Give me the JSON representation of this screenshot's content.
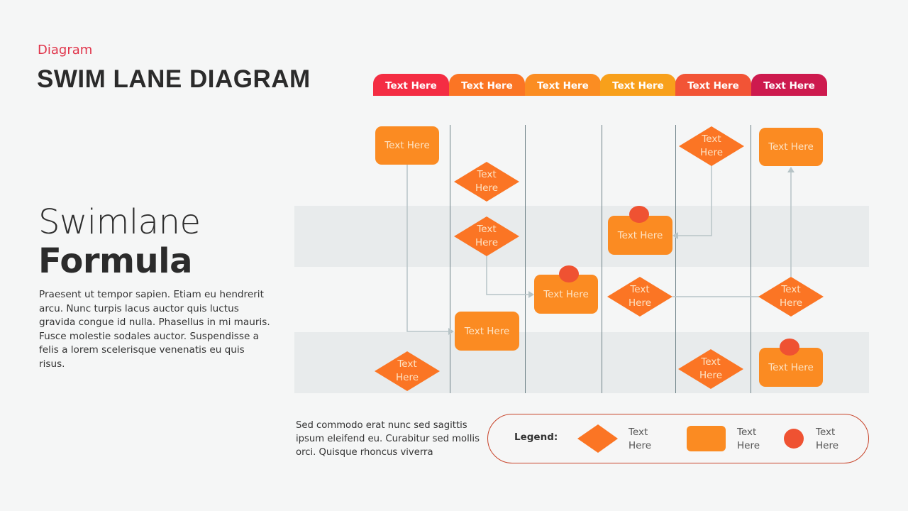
{
  "header": {
    "category": "Diagram",
    "title": "SWIM LANE DIAGRAM"
  },
  "intro": {
    "heading_light": "Swimlane",
    "heading_bold": "Formula",
    "paragraph": "Praesent ut tempor  sapien. Etiam eu hendrerit arcu. Nunc turpis lacus auctor quis luctus gravida congue id nulla. Phasellus in mi mauris. Fusce molestie sodales auctor. Suspendisse a felis a lorem  scelerisque venenatis eu quis risus."
  },
  "lanes": [
    {
      "label": "Text Here",
      "color": "#f42d43"
    },
    {
      "label": "Text Here",
      "color": "#fb7524"
    },
    {
      "label": "Text Here",
      "color": "#fb8d22"
    },
    {
      "label": "Text Here",
      "color": "#f8a01b"
    },
    {
      "label": "Text Here",
      "color": "#f25436"
    },
    {
      "label": "Text Here",
      "color": "#cd1a4e"
    }
  ],
  "nodes": {
    "box_1": {
      "type": "process",
      "label": "Text Here"
    },
    "dia_1": {
      "type": "decision",
      "line1": "Text",
      "line2": "Here"
    },
    "dia_2": {
      "type": "decision",
      "line1": "Text",
      "line2": "Here"
    },
    "box_2": {
      "type": "process",
      "label": "Text Here"
    },
    "dia_3": {
      "type": "decision",
      "line1": "Text",
      "line2": "Here"
    },
    "box_3": {
      "type": "process",
      "label": "Text Here",
      "marker": true
    },
    "box_4": {
      "type": "process",
      "label": "Text Here",
      "marker": true
    },
    "dia_4": {
      "type": "decision",
      "line1": "Text",
      "line2": "Here"
    },
    "dia_5": {
      "type": "decision",
      "line1": "Text",
      "line2": "Here"
    },
    "box_5": {
      "type": "process",
      "label": "Text Here"
    },
    "dia_6": {
      "type": "decision",
      "line1": "Text",
      "line2": "Here"
    },
    "dia_7": {
      "type": "decision",
      "line1": "Text",
      "line2": "Here"
    },
    "dia_8": {
      "type": "decision",
      "line1": "Text",
      "line2": "Here"
    },
    "box_6": {
      "type": "process",
      "label": "Text Here",
      "marker": true
    }
  },
  "footer": {
    "paragraph": "Sed commodo  erat nunc sed sagittis ipsum eleifend eu. Curabitur sed mollis orci. Quisque rhoncus viverra"
  },
  "legend": {
    "title": "Legend:",
    "items": [
      {
        "shape": "diamond",
        "line1": "Text",
        "line2": "Here"
      },
      {
        "shape": "rounded-rectangle",
        "line1": "Text",
        "line2": "Here"
      },
      {
        "shape": "circle",
        "line1": "Text",
        "line2": "Here"
      }
    ]
  },
  "colors": {
    "accent": "#e0344a",
    "node_fill": "#fb8b22",
    "decision_fill": "#fb7524",
    "marker_fill": "#ef5232",
    "connector": "#b7c4c7"
  }
}
